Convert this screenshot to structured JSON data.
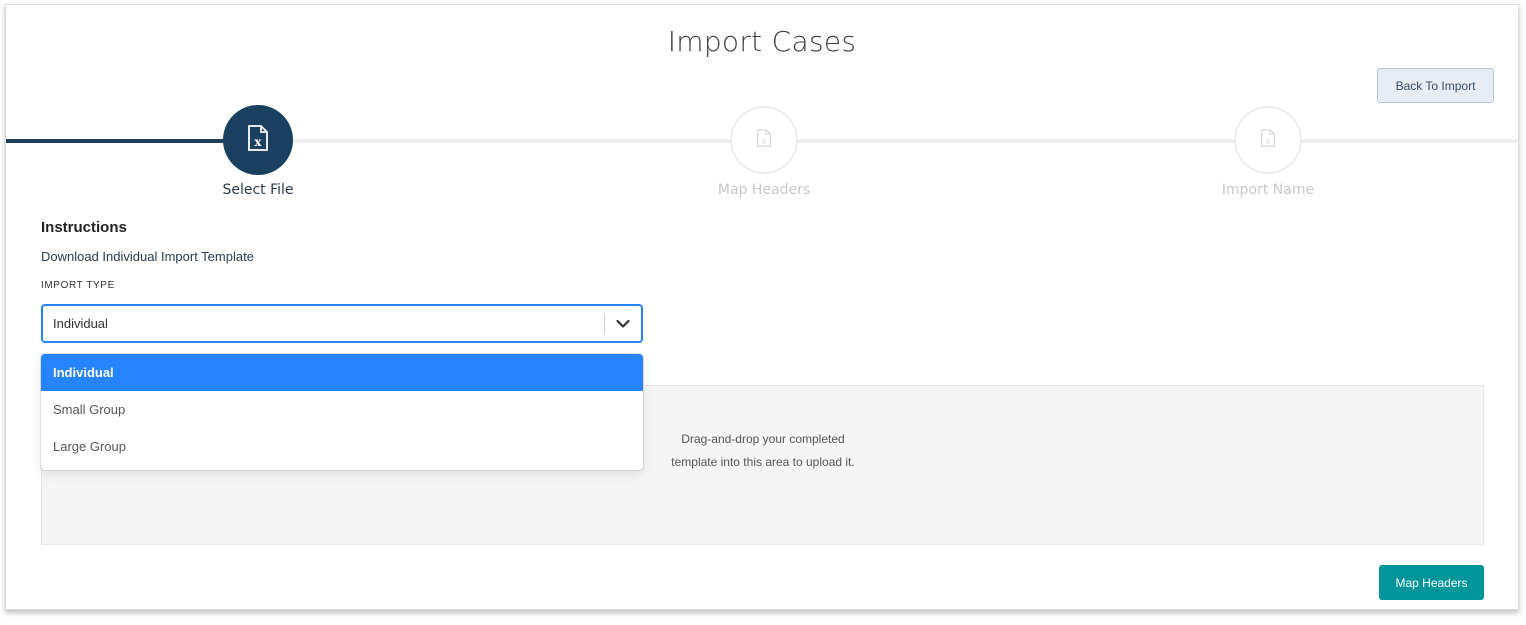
{
  "header": {
    "title": "Import Cases",
    "back_label": "Back To Import"
  },
  "steps": [
    {
      "label": "Select File",
      "state": "active"
    },
    {
      "label": "Map Headers",
      "state": "inactive"
    },
    {
      "label": "Import Name",
      "state": "inactive"
    }
  ],
  "instructions": {
    "title": "Instructions",
    "download_link": "Download Individual Import Template"
  },
  "import_type": {
    "label": "IMPORT TYPE",
    "selected": "Individual",
    "options": [
      "Individual",
      "Small Group",
      "Large Group"
    ]
  },
  "dropzone": {
    "line1": "Drag-and-drop your completed",
    "line2": "template into this area to upload it."
  },
  "footer": {
    "next_label": "Map Headers"
  },
  "colors": {
    "accent": "#1b3f5f",
    "select_focus": "#2684ff",
    "primary_button": "#00959a"
  },
  "icons": {
    "step": "excel-file-icon",
    "dropdown": "chevron-down-icon"
  }
}
